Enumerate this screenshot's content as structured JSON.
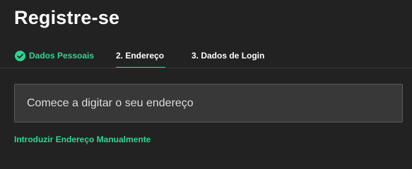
{
  "page": {
    "title": "Registre-se"
  },
  "steps": [
    {
      "label": "Dados Pessoais",
      "status": "completed",
      "icon": "check-circle-icon"
    },
    {
      "label": "2. Endereço",
      "status": "active"
    },
    {
      "label": "3. Dados de Login",
      "status": "pending"
    }
  ],
  "address": {
    "placeholder": "Comece a digitar o seu endereço",
    "value": ""
  },
  "manual_link": {
    "label": "Introduzir Endereço Manualmente"
  },
  "colors": {
    "background": "#222222",
    "accent": "#2fd68f",
    "input_background": "#383838",
    "input_border": "#5a5a5a"
  }
}
